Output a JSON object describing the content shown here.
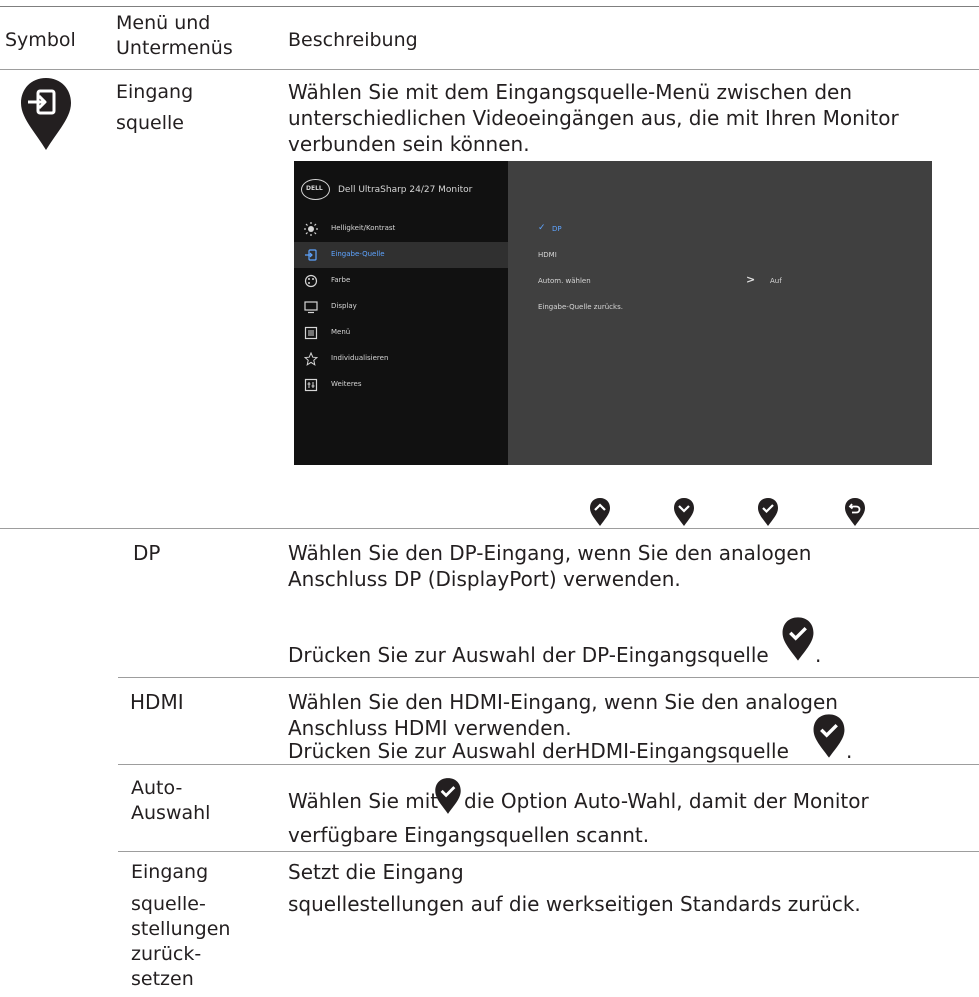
{
  "header": {
    "col_symbol": "Symbol",
    "col_menu_line1": "Menü und",
    "col_menu_line2": "Untermenüs",
    "col_desc": "Beschreibung"
  },
  "main_row": {
    "menu_line1": "Eingang",
    "menu_line2": "squelle",
    "desc_line1": "Wählen Sie mit dem Eingangsquelle-Menü zwischen den",
    "desc_line2": "unterschiedlichen Videoeingängen aus, die mit Ihren Monitor",
    "desc_line3": "verbunden sein können."
  },
  "osd": {
    "brand_logo": "DELL",
    "title": "Dell UltraSharp 24/27 Monitor",
    "menu": [
      {
        "label": "Helligkeit/Kontrast",
        "icon": "brightness-icon"
      },
      {
        "label": "Eingabe-Quelle",
        "icon": "input-source-icon"
      },
      {
        "label": "Farbe",
        "icon": "color-palette-icon"
      },
      {
        "label": "Display",
        "icon": "display-icon"
      },
      {
        "label": "Menü",
        "icon": "menu-icon"
      },
      {
        "label": "Individualisieren",
        "icon": "star-icon"
      },
      {
        "label": "Weiteres",
        "icon": "others-icon"
      }
    ],
    "options": {
      "dp": "DP",
      "hdmi": "HDMI",
      "auto_select": "Autom. wählen",
      "auto_value": "Auf",
      "reset": "Eingabe-Quelle zurücks."
    },
    "colors": {
      "active": "#5ea4ff",
      "panel_left": "#111111",
      "panel_right": "#404040"
    }
  },
  "button_icons": [
    "up-icon",
    "down-icon",
    "check-icon",
    "back-icon"
  ],
  "rows": {
    "dp": {
      "label": "DP",
      "desc_line1": "Wählen Sie den DP-Eingang, wenn Sie den analogen",
      "desc_line2": "Anschluss DP (DisplayPort) verwenden.",
      "desc_line3": "Drücken Sie zur Auswahl der DP-Eingangsquelle",
      "desc_end": "."
    },
    "hdmi": {
      "label": "HDMI",
      "desc_line1": "Wählen Sie den HDMI-Eingang, wenn Sie den analogen",
      "desc_line2": "Anschluss HDMI verwenden.",
      "desc_line3": "Drücken Sie zur Auswahl derHDMI-Eingangsquelle",
      "desc_end": "."
    },
    "auto": {
      "label_line1": "Auto-",
      "label_line2": "Auswahl",
      "desc_pre": "Wählen Sie mit",
      "desc_post": "die Option Auto-Wahl, damit der Monitor",
      "desc_line2": "verfügbare Eingangsquellen scannt."
    },
    "reset": {
      "label_line1": "Eingang",
      "label_line2": "squelle-",
      "label_line3": "stellungen",
      "label_line4": "zurück-",
      "label_line5": "setzen",
      "desc_line1": "Setzt die Eingang",
      "desc_line2": "squellestellungen auf die werkseitigen Standards zurück."
    }
  }
}
